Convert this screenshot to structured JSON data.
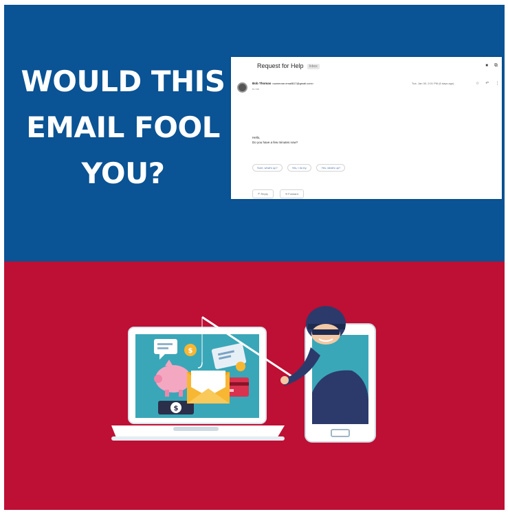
{
  "headline": {
    "lines": [
      "WOULD THIS",
      "EMAIL FOOL",
      "YOU?"
    ]
  },
  "email": {
    "subject": "Request for Help",
    "tag": "Inbox",
    "sender_name": "Bob Thomas",
    "sender_email": "<someone.email817@gmail.com>",
    "to": "to me",
    "date": "Tue, Jan 30, 2:01 PM (6 days ago)",
    "greeting": "Hello,",
    "body": "Do you have a few minutes now?",
    "smart_replies": [
      "Sure, what's up?",
      "Yes, I do try.",
      "Yes, what's up?"
    ],
    "reply_label": "Reply",
    "forward_label": "Forward"
  },
  "colors": {
    "top": "#0a5394",
    "bottom": "#be0f34",
    "laptop_screen": "#3aa7b8"
  },
  "icons": [
    "printer-icon",
    "open-new-window-icon",
    "star-icon",
    "reply-icon",
    "more-icon",
    "piggy-bank-icon",
    "envelope-icon",
    "credit-card-icon",
    "dollar-coin-icon",
    "chat-bubble-icon",
    "hacker-icon",
    "fishing-rod-icon"
  ]
}
